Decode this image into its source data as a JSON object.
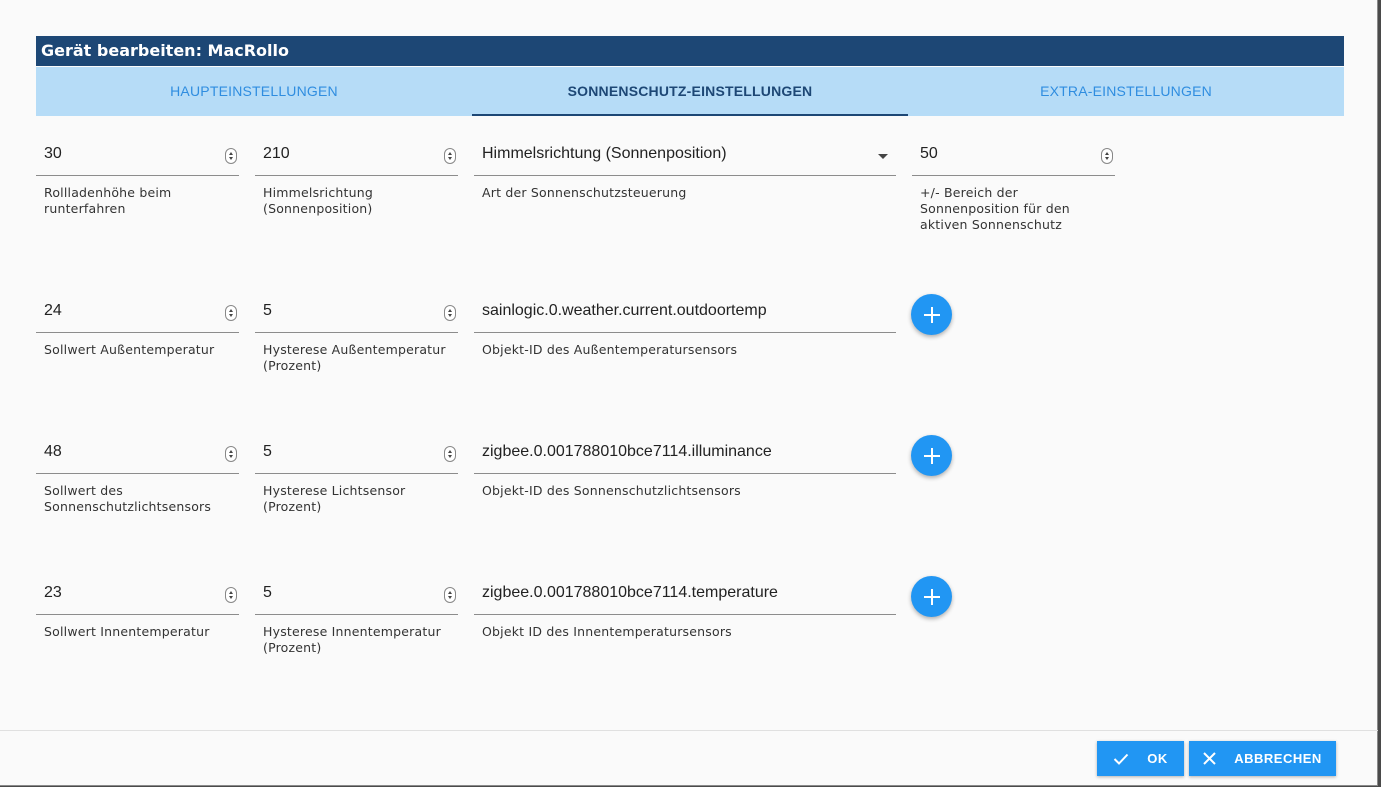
{
  "dialog": {
    "title": "Gerät bearbeiten: MacRollo"
  },
  "tabs": [
    {
      "label": "HAUPTEINSTELLUNGEN",
      "active": false
    },
    {
      "label": "SONNENSCHUTZ-EINSTELLUNGEN",
      "active": true
    },
    {
      "label": "EXTRA-EINSTELLUNGEN",
      "active": false
    }
  ],
  "row1": {
    "shutter_height": {
      "value": "30",
      "label": "Rollladenhöhe beim runterfahren"
    },
    "sun_direction": {
      "value": "210",
      "label": "Himmelsrichtung (Sonnenposition)"
    },
    "sun_control_type": {
      "value": "Himmelsrichtung (Sonnenposition)",
      "label": "Art der Sonnenschutzsteuerung"
    },
    "sun_range": {
      "value": "50",
      "label": "+/- Bereich der Sonnenposition für den aktiven Sonnenschutz"
    }
  },
  "row2": {
    "outside_temp_setpoint": {
      "value": "24",
      "label": "Sollwert Außentemperatur"
    },
    "outside_temp_hysteresis": {
      "value": "5",
      "label": "Hysterese Außentemperatur (Prozent)"
    },
    "outside_temp_object": {
      "value": "sainlogic.0.weather.current.outdoortemp",
      "label": "Objekt-ID des Außentemperatursensors"
    }
  },
  "row3": {
    "light_setpoint": {
      "value": "48",
      "label": "Sollwert des Sonnenschutzlichtsensors"
    },
    "light_hysteresis": {
      "value": "5",
      "label": "Hysterese Lichtsensor (Prozent)"
    },
    "light_object": {
      "value": "zigbee.0.001788010bce7114.illuminance",
      "label": "Objekt-ID des Sonnenschutzlichtsensors"
    }
  },
  "row4": {
    "inside_temp_setpoint": {
      "value": "23",
      "label": "Sollwert Innentemperatur"
    },
    "inside_temp_hysteresis": {
      "value": "5",
      "label": "Hysterese Innentemperatur (Prozent)"
    },
    "inside_temp_object": {
      "value": "zigbee.0.001788010bce7114.temperature",
      "label": "Objekt ID des Innentemperatursensors"
    }
  },
  "footer": {
    "ok_label": "OK",
    "cancel_label": "ABBRECHEN"
  },
  "colors": {
    "header": "#1d4775",
    "tabs_bg": "#b6dcf7",
    "accent": "#2196f3"
  }
}
